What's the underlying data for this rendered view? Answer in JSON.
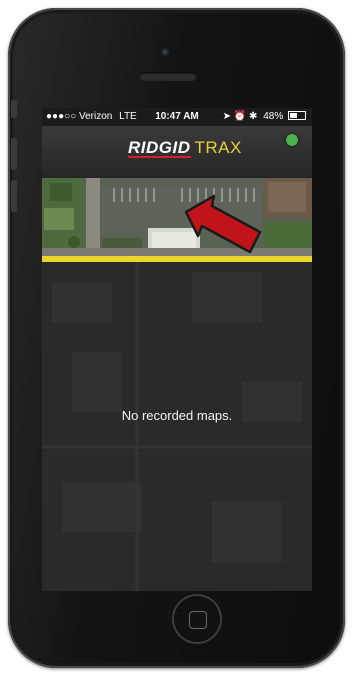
{
  "status_bar": {
    "carrier": "●●●○○ Verizon",
    "network": "LTE",
    "time": "10:47 AM",
    "icons": "➤ ⏰ ✱",
    "battery_percent": "48%",
    "battery_level": 0.48
  },
  "app_bar": {
    "brand_primary": "RIDGID",
    "brand_secondary": "TRAX",
    "status_dot_color": "#4caf50"
  },
  "map": {
    "add_button_label": "+"
  },
  "content": {
    "empty_message": "No recorded maps."
  },
  "colors": {
    "accent_yellow": "#e9d62a",
    "brand_red": "#d4202a",
    "add_button": "#d8262d",
    "arrow_red": "#c0141a"
  }
}
